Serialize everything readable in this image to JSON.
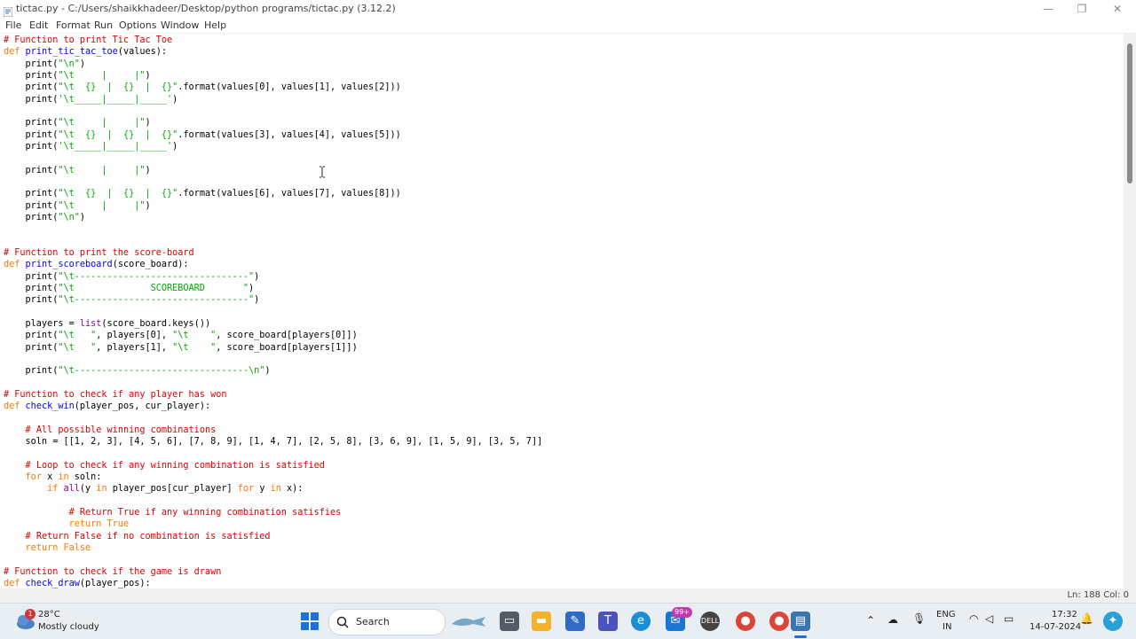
{
  "window": {
    "title": "tictac.py - C:/Users/shaikkhadeer/Desktop/python programs/tictac.py (3.12.2)",
    "controls": {
      "minimize": "—",
      "maximize": "❐",
      "close": "✕"
    }
  },
  "menu": {
    "items": [
      "File",
      "Edit",
      "Format",
      "Run",
      "Options",
      "Window",
      "Help"
    ]
  },
  "editor": {
    "lines": [
      [
        [
          "cm",
          "# Function to print Tic Tac Toe"
        ]
      ],
      [
        [
          "kw",
          "def "
        ],
        [
          "df",
          "print_tic_tac_toe"
        ],
        [
          "t",
          "(values):"
        ]
      ],
      [
        [
          "t",
          "    print("
        ],
        [
          "st",
          "\"\\n\""
        ],
        [
          "t",
          ")"
        ]
      ],
      [
        [
          "t",
          "    print("
        ],
        [
          "st",
          "\"\\t     |     |\""
        ],
        [
          "t",
          ")"
        ]
      ],
      [
        [
          "t",
          "    print("
        ],
        [
          "st",
          "\"\\t  {}  |  {}  |  {}\""
        ],
        [
          "t",
          ".format(values[0], values[1], values[2]))"
        ]
      ],
      [
        [
          "t",
          "    print("
        ],
        [
          "st",
          "'\\t_____|_____|_____'"
        ],
        [
          "t",
          ")"
        ]
      ],
      [],
      [
        [
          "t",
          "    print("
        ],
        [
          "st",
          "\"\\t     |     |\""
        ],
        [
          "t",
          ")"
        ]
      ],
      [
        [
          "t",
          "    print("
        ],
        [
          "st",
          "\"\\t  {}  |  {}  |  {}\""
        ],
        [
          "t",
          ".format(values[3], values[4], values[5]))"
        ]
      ],
      [
        [
          "t",
          "    print("
        ],
        [
          "st",
          "'\\t_____|_____|_____'"
        ],
        [
          "t",
          ")"
        ]
      ],
      [],
      [
        [
          "t",
          "    print("
        ],
        [
          "st",
          "\"\\t     |     |\""
        ],
        [
          "t",
          ")"
        ]
      ],
      [],
      [
        [
          "t",
          "    print("
        ],
        [
          "st",
          "\"\\t  {}  |  {}  |  {}\""
        ],
        [
          "t",
          ".format(values[6], values[7], values[8]))"
        ]
      ],
      [
        [
          "t",
          "    print("
        ],
        [
          "st",
          "\"\\t     |     |\""
        ],
        [
          "t",
          ")"
        ]
      ],
      [
        [
          "t",
          "    print("
        ],
        [
          "st",
          "\"\\n\""
        ],
        [
          "t",
          ")"
        ]
      ],
      [],
      [],
      [
        [
          "cm",
          "# Function to print the score-board"
        ]
      ],
      [
        [
          "kw",
          "def "
        ],
        [
          "df",
          "print_scoreboard"
        ],
        [
          "t",
          "(score_board):"
        ]
      ],
      [
        [
          "t",
          "    print("
        ],
        [
          "st",
          "\"\\t--------------------------------\""
        ],
        [
          "t",
          ")"
        ]
      ],
      [
        [
          "t",
          "    print("
        ],
        [
          "st",
          "\"\\t              SCOREBOARD       \""
        ],
        [
          "t",
          ")"
        ]
      ],
      [
        [
          "t",
          "    print("
        ],
        [
          "st",
          "\"\\t--------------------------------\""
        ],
        [
          "t",
          ")"
        ]
      ],
      [],
      [
        [
          "t",
          "    players = "
        ],
        [
          "bi",
          "list"
        ],
        [
          "t",
          "(score_board.keys())"
        ]
      ],
      [
        [
          "t",
          "    print("
        ],
        [
          "st",
          "\"\\t   \""
        ],
        [
          "t",
          ", players[0], "
        ],
        [
          "st",
          "\"\\t    \""
        ],
        [
          "t",
          ", score_board[players[0]])"
        ]
      ],
      [
        [
          "t",
          "    print("
        ],
        [
          "st",
          "\"\\t   \""
        ],
        [
          "t",
          ", players[1], "
        ],
        [
          "st",
          "\"\\t    \""
        ],
        [
          "t",
          ", score_board[players[1]])"
        ]
      ],
      [],
      [
        [
          "t",
          "    print("
        ],
        [
          "st",
          "\"\\t--------------------------------\\n\""
        ],
        [
          "t",
          ")"
        ]
      ],
      [],
      [
        [
          "cm",
          "# Function to check if any player has won"
        ]
      ],
      [
        [
          "kw",
          "def "
        ],
        [
          "df",
          "check_win"
        ],
        [
          "t",
          "(player_pos, cur_player):"
        ]
      ],
      [],
      [
        [
          "t",
          "    "
        ],
        [
          "cm",
          "# All possible winning combinations"
        ]
      ],
      [
        [
          "t",
          "    soln = [[1, 2, 3], [4, 5, 6], [7, 8, 9], [1, 4, 7], [2, 5, 8], [3, 6, 9], [1, 5, 9], [3, 5, 7]]"
        ]
      ],
      [],
      [
        [
          "t",
          "    "
        ],
        [
          "cm",
          "# Loop to check if any winning combination is satisfied"
        ]
      ],
      [
        [
          "t",
          "    "
        ],
        [
          "kw",
          "for"
        ],
        [
          "t",
          " x "
        ],
        [
          "kw",
          "in"
        ],
        [
          "t",
          " soln:"
        ]
      ],
      [
        [
          "t",
          "        "
        ],
        [
          "kw",
          "if"
        ],
        [
          "t",
          " "
        ],
        [
          "bi",
          "all"
        ],
        [
          "t",
          "(y "
        ],
        [
          "kw",
          "in"
        ],
        [
          "t",
          " player_pos[cur_player] "
        ],
        [
          "kw",
          "for"
        ],
        [
          "t",
          " y "
        ],
        [
          "kw",
          "in"
        ],
        [
          "t",
          " x):"
        ]
      ],
      [],
      [
        [
          "t",
          "            "
        ],
        [
          "cm",
          "# Return True if any winning combination satisfies"
        ]
      ],
      [
        [
          "t",
          "            "
        ],
        [
          "kw",
          "return True"
        ]
      ],
      [
        [
          "t",
          "    "
        ],
        [
          "cm",
          "# Return False if no combination is satisfied"
        ]
      ],
      [
        [
          "t",
          "    "
        ],
        [
          "kw",
          "return False"
        ]
      ],
      [],
      [
        [
          "cm",
          "# Function to check if the game is drawn"
        ]
      ],
      [
        [
          "kw",
          "def "
        ],
        [
          "df",
          "check_draw"
        ],
        [
          "t",
          "(player_pos):"
        ]
      ]
    ]
  },
  "status": {
    "position": "Ln: 188  Col: 0"
  },
  "taskbar": {
    "weather_badge": "1",
    "temperature": "28°C",
    "condition": "Mostly cloudy",
    "search_label": "Search",
    "mail_badge": "99+",
    "language_top": "ENG",
    "language_bottom": "IN",
    "time": "17:32",
    "date": "14-07-2024"
  },
  "colors": {
    "keyword": "#ff7700",
    "builtin": "#900090",
    "string": "#00aa00",
    "comment": "#dd0000",
    "definition": "#0000ff"
  }
}
